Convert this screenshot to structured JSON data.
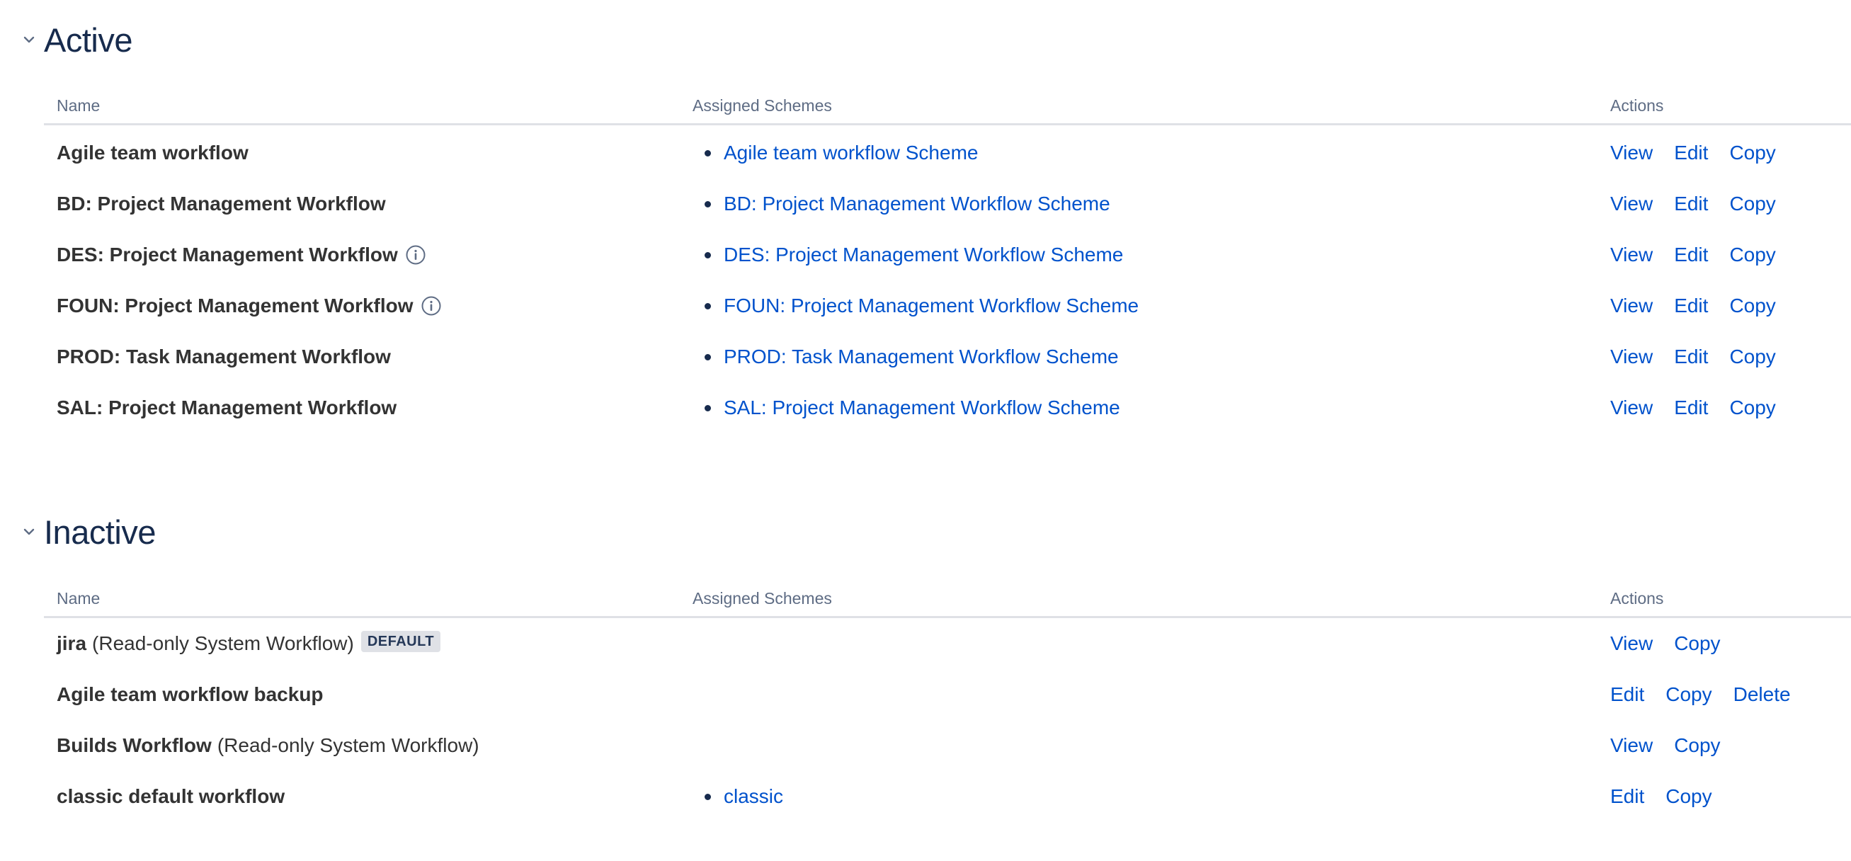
{
  "columns": {
    "name": "Name",
    "schemes": "Assigned Schemes",
    "actions": "Actions"
  },
  "active": {
    "title": "Active",
    "rows": [
      {
        "name": "Agile team workflow",
        "info": false,
        "schemes": [
          "Agile team workflow Scheme"
        ],
        "actions": [
          "View",
          "Edit",
          "Copy"
        ]
      },
      {
        "name": "BD: Project Management Workflow",
        "info": false,
        "schemes": [
          "BD: Project Management Workflow Scheme"
        ],
        "actions": [
          "View",
          "Edit",
          "Copy"
        ]
      },
      {
        "name": "DES: Project Management Workflow",
        "info": true,
        "schemes": [
          "DES: Project Management Workflow Scheme"
        ],
        "actions": [
          "View",
          "Edit",
          "Copy"
        ]
      },
      {
        "name": "FOUN: Project Management Workflow",
        "info": true,
        "schemes": [
          "FOUN: Project Management Workflow Scheme"
        ],
        "actions": [
          "View",
          "Edit",
          "Copy"
        ]
      },
      {
        "name": "PROD: Task Management Workflow",
        "info": false,
        "schemes": [
          "PROD: Task Management Workflow Scheme"
        ],
        "actions": [
          "View",
          "Edit",
          "Copy"
        ]
      },
      {
        "name": "SAL: Project Management Workflow",
        "info": false,
        "schemes": [
          "SAL: Project Management Workflow Scheme"
        ],
        "actions": [
          "View",
          "Edit",
          "Copy"
        ]
      }
    ]
  },
  "inactive": {
    "title": "Inactive",
    "rows": [
      {
        "name": "jira",
        "suffix": "(Read-only System Workflow)",
        "badge": "DEFAULT",
        "schemes": [],
        "actions": [
          "View",
          "Copy"
        ]
      },
      {
        "name": "Agile team workflow backup",
        "schemes": [],
        "actions": [
          "Edit",
          "Copy",
          "Delete"
        ]
      },
      {
        "name": "Builds Workflow",
        "suffix": "(Read-only System Workflow)",
        "schemes": [],
        "actions": [
          "View",
          "Copy"
        ]
      },
      {
        "name": "classic default workflow",
        "schemes": [
          "classic"
        ],
        "actions": [
          "Edit",
          "Copy"
        ]
      }
    ]
  },
  "colors": {
    "link": "#0052cc",
    "heading": "#172b4d",
    "muted": "#5e6c84",
    "divider": "#dfe1e6"
  },
  "icons": {
    "collapse": "chevron-down-icon",
    "info": "info-icon"
  }
}
